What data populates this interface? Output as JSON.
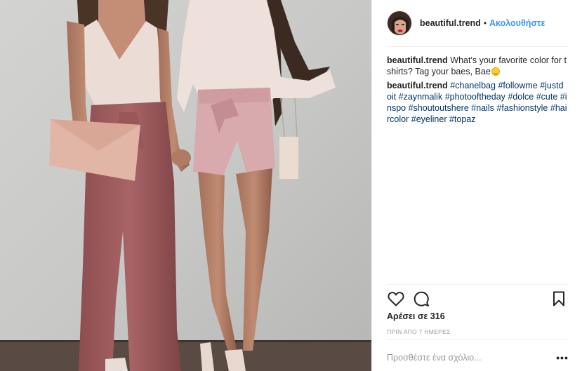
{
  "header": {
    "username": "beautiful.trend",
    "separator": "•",
    "follow_label": "Ακολουθήστε"
  },
  "caption": {
    "username": "beautiful.trend",
    "text": "What's your favorite color for t shirts? Tag your baes, Bae"
  },
  "hashtag_comment": {
    "username": "beautiful.trend",
    "tags": [
      "#chanelbag",
      "#followme",
      "#justdoit",
      "#zaynmalik",
      "#photooftheday",
      "#dolce",
      "#cute",
      "#inspo",
      "#shoutoutshere",
      "#nails",
      "#fashionstyle",
      "#haircolor",
      "#eyeliner",
      "#topaz"
    ]
  },
  "actions": {
    "like_icon": "heart-icon",
    "comment_icon": "comment-bubble-icon",
    "save_icon": "bookmark-icon"
  },
  "likes_label": "Αρέσει σε 316",
  "timestamp": "ΠΡΙΝ ΑΠΟ 7 ΗΜΕΡΕΣ",
  "add_comment": {
    "placeholder": "Προσθέστε ένα σχόλιο...",
    "more_label": "•••"
  },
  "colors": {
    "link_blue": "#3897f0",
    "hashtag": "#003569",
    "muted": "#999999"
  }
}
